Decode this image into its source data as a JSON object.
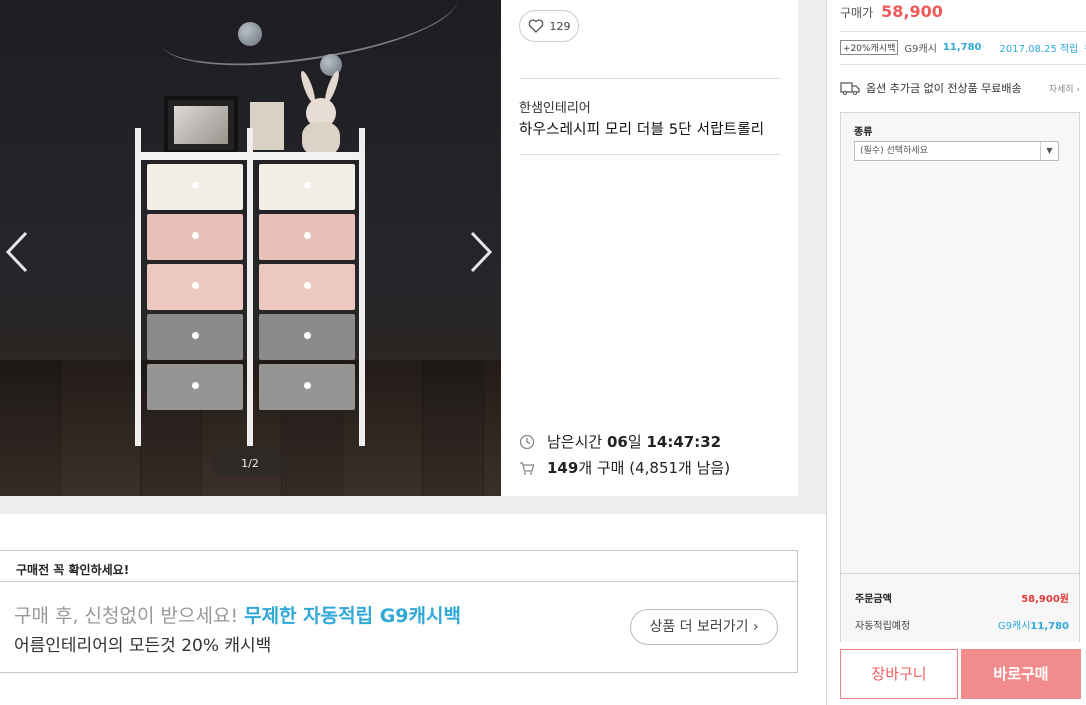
{
  "gallery": {
    "pager": "1/2",
    "prev_icon": "chevron-left-icon",
    "next_icon": "chevron-right-icon"
  },
  "info": {
    "likes": "129",
    "brand": "한샘인테리어",
    "title": "하우스레시피 모리 더블 5단 서랍트롤리",
    "time_label": "남은시간",
    "time_days": "06",
    "time_days_unit": "일",
    "time_clock": "14:47:32",
    "purchase_count": "149",
    "purchase_unit": "개 구매",
    "remaining": "(4,851개 남음)"
  },
  "notice": {
    "heading": "구매전 꼭 확인하세요!",
    "line1_plain": "구매 후, 신청없이 받으세요! ",
    "line1_highlight": "무제한 자동적립 G9캐시백",
    "line2": "어름인테리어의 모든것 20% 캐시백",
    "more_button": "상품 더 보러가기"
  },
  "panel": {
    "price_label": "구매가",
    "price": "58,900",
    "cash_badge": "+20%캐시백",
    "cash_label": "G9캐시",
    "cash_amount": "11,780",
    "cash_date": "2017.08.25 적립",
    "shipping": "옵션 추가금 없이 전상품 무료배송",
    "shipping_detail": "자세히",
    "option_label": "종류",
    "option_placeholder": "(필수) 선택하세요",
    "order_total_label": "주문금액",
    "order_total": "58,900원",
    "reward_label": "자동적립예정",
    "reward_prefix": "G9캐시",
    "reward_amount": "11,780",
    "cart_button": "장바구니",
    "buy_button": "바로구매"
  },
  "colors": {
    "accent_red": "#ef5a5a",
    "accent_blue": "#31a9d8",
    "buy_bg": "#f28b8b"
  }
}
